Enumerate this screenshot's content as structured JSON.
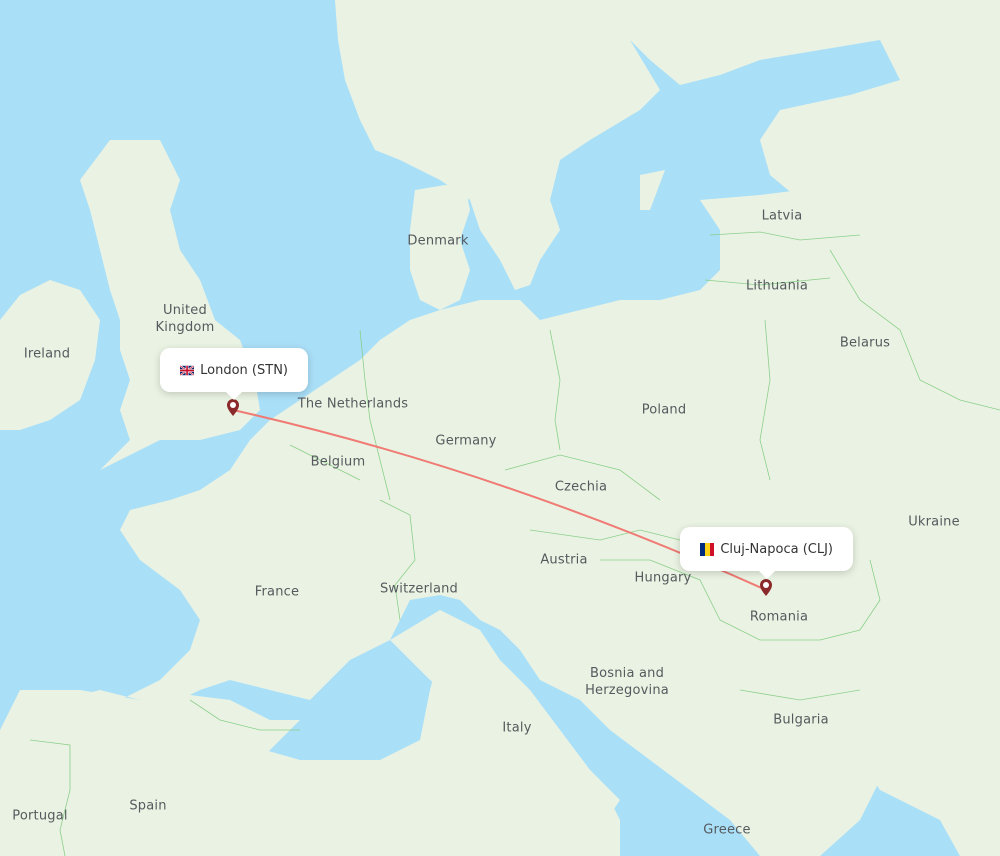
{
  "map": {
    "colors": {
      "water": "#aadff8",
      "land": "#eaf3e3",
      "border": "#8ccf8a",
      "route": "#f07a74",
      "pin": "#8b2a2a"
    },
    "route": {
      "origin": {
        "city": "London",
        "code": "STN",
        "label": "London (STN)",
        "country": "United Kingdom",
        "flag": "uk-flag"
      },
      "destination": {
        "city": "Cluj-Napoca",
        "code": "CLJ",
        "label": "Cluj-Napoca (CLJ)",
        "country": "Romania",
        "flag": "romania-flag"
      }
    },
    "country_labels": [
      {
        "name": "Denmark"
      },
      {
        "name": "Latvia"
      },
      {
        "name": "Lithuania"
      },
      {
        "name": "United Kingdom"
      },
      {
        "name": "Ireland"
      },
      {
        "name": "Belarus"
      },
      {
        "name": "The Netherlands"
      },
      {
        "name": "Poland"
      },
      {
        "name": "Germany"
      },
      {
        "name": "Belgium"
      },
      {
        "name": "Czechia"
      },
      {
        "name": "Ukraine"
      },
      {
        "name": "Austria"
      },
      {
        "name": "Hungary"
      },
      {
        "name": "France"
      },
      {
        "name": "Switzerland"
      },
      {
        "name": "Romania"
      },
      {
        "name": "Bosnia and Herzegovina"
      },
      {
        "name": "Bulgaria"
      },
      {
        "name": "Italy"
      },
      {
        "name": "Spain"
      },
      {
        "name": "Portugal"
      },
      {
        "name": "Greece"
      }
    ]
  }
}
